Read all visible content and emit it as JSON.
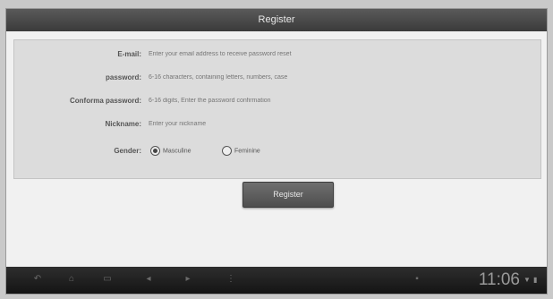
{
  "window": {
    "title": "Register"
  },
  "form": {
    "email": {
      "label": "E-mail:",
      "placeholder": "Enter your email address to receive password reset"
    },
    "password": {
      "label": "password:",
      "placeholder": "6-16 characters, containing letters, numbers, case"
    },
    "confirm_password": {
      "label": "Conforma password:",
      "placeholder": "6-16 digits, Enter the password confirmation"
    },
    "nickname": {
      "label": "Nickname:",
      "placeholder": "Enter your nickname"
    },
    "gender": {
      "label": "Gender:",
      "options": [
        {
          "label": "Masculine",
          "selected": true
        },
        {
          "label": "Feminine",
          "selected": false
        }
      ]
    }
  },
  "register_button": {
    "label": "Register"
  },
  "system_bar": {
    "clock": "11:06",
    "nav_icons": [
      "back-icon",
      "home-icon",
      "recent-apps-icon",
      "volume-down-icon",
      "volume-up-icon",
      "menu-icon"
    ],
    "status_icons": [
      "wifi-icon",
      "battery-icon"
    ]
  }
}
